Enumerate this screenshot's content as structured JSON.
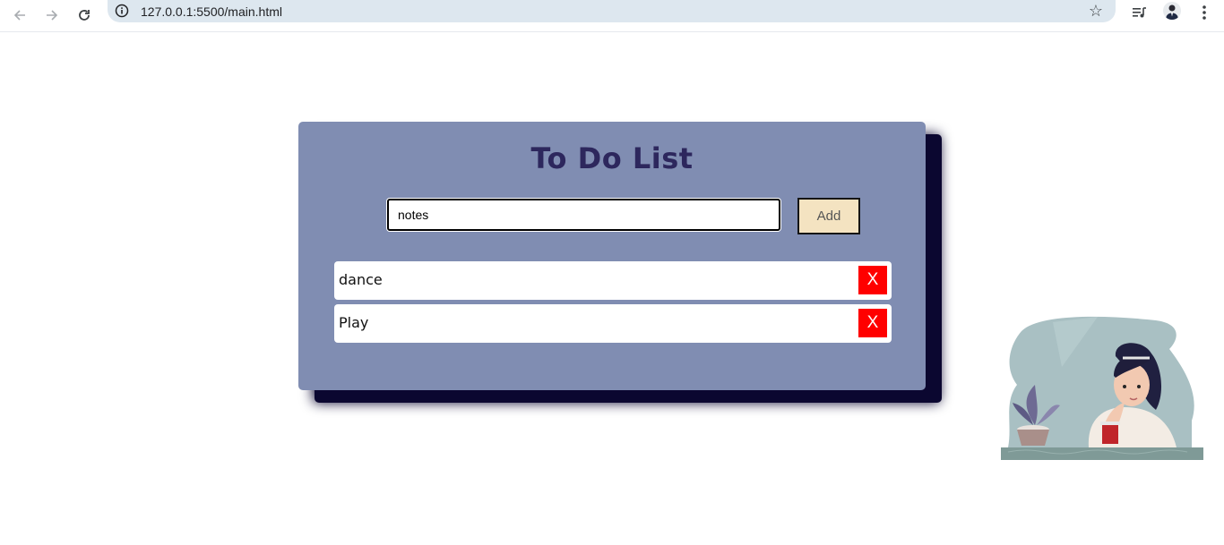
{
  "browser": {
    "url": "127.0.0.1:5500/main.html",
    "back_icon": "arrow-left-icon",
    "forward_icon": "arrow-right-icon",
    "reload_icon": "reload-icon",
    "info_icon": "info-icon",
    "bookmark_icon": "star-icon",
    "media_icon": "media-queue-icon",
    "menu_icon": "kebab-menu-icon"
  },
  "todo": {
    "title": "To Do List",
    "input_value": "notes",
    "add_label": "Add",
    "items": [
      {
        "text": "dance",
        "delete_label": "X"
      },
      {
        "text": "Play",
        "delete_label": "X"
      }
    ]
  },
  "colors": {
    "card_bg": "#808db2",
    "card_shadow": "#0b0730",
    "title": "#2d275d",
    "add_button_bg": "#f4e3c1",
    "delete_button_bg": "#ff0000"
  }
}
